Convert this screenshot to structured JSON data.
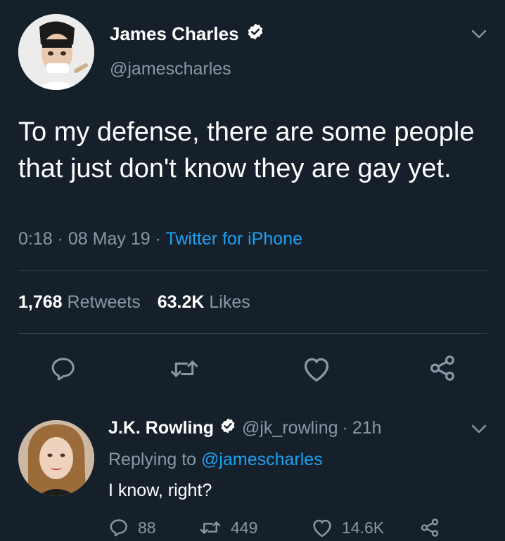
{
  "tweet": {
    "author_name": "James Charles",
    "author_handle": "@jamescharles",
    "text": "To my defense, there are some people that just don't know they are gay yet.",
    "time": "0:18",
    "date": "08 May 19",
    "separator": "·",
    "source": "Twitter for iPhone",
    "retweets_count": "1,768",
    "retweets_label": "Retweets",
    "likes_count": "63.2K",
    "likes_label": "Likes"
  },
  "reply": {
    "author_name": "J.K. Rowling",
    "author_handle": "@jk_rowling",
    "age": "21h",
    "replying_prefix": "Replying to",
    "replying_mention": "@jamescharles",
    "text": "I know, right?",
    "reply_count": "88",
    "retweet_count": "449",
    "like_count": "14.6K"
  },
  "icons": {
    "verified": "verified-badge-icon",
    "menu": "chevron-down-icon",
    "reply": "reply-icon",
    "retweet": "retweet-icon",
    "like": "heart-icon",
    "share": "share-icon"
  },
  "colors": {
    "background": "#15202b",
    "text": "#ffffff",
    "muted": "#8899a6",
    "link": "#1da1f2",
    "divider": "#38444d"
  }
}
